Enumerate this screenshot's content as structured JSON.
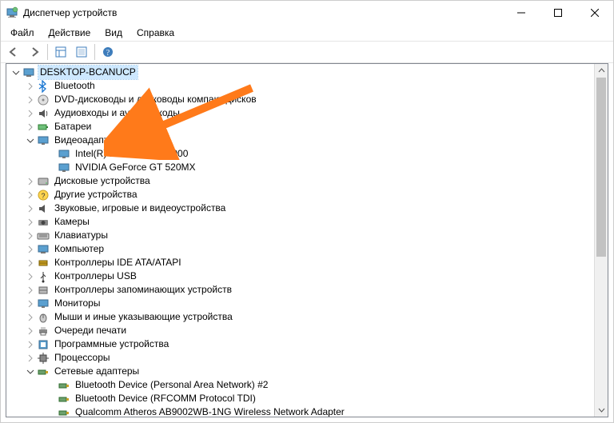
{
  "window": {
    "title": "Диспетчер устройств"
  },
  "menubar": {
    "file": "Файл",
    "action": "Действие",
    "view": "Вид",
    "help": "Справка"
  },
  "tree": {
    "root": "DESKTOP-BCANUCP",
    "bluetooth": "Bluetooth",
    "dvd": "DVD-дисководы и дисководы компакт-дисков",
    "audio": "Аудиовходы и аудиовыходы",
    "batteries": "Батареи",
    "video": "Видеоадаптеры",
    "video_intel": "Intel(R) HD Graphics 3000",
    "video_nvidia": "NVIDIA GeForce GT 520MX",
    "disk": "Дисковые устройства",
    "other": "Другие устройства",
    "sound": "Звуковые, игровые и видеоустройства",
    "cameras": "Камеры",
    "keyboards": "Клавиатуры",
    "computer": "Компьютер",
    "ide": "Контроллеры IDE ATA/ATAPI",
    "usb": "Контроллеры USB",
    "storage_ctrl": "Контроллеры запоминающих устройств",
    "monitors": "Мониторы",
    "mice": "Мыши и иные указывающие устройства",
    "print_queues": "Очереди печати",
    "software": "Программные устройства",
    "cpu": "Процессоры",
    "net": "Сетевые адаптеры",
    "net_pan": "Bluetooth Device (Personal Area Network) #2",
    "net_rfcomm": "Bluetooth Device (RFCOMM Protocol TDI)",
    "net_atheros": "Qualcomm Atheros AB9002WB-1NG Wireless Network Adapter"
  }
}
